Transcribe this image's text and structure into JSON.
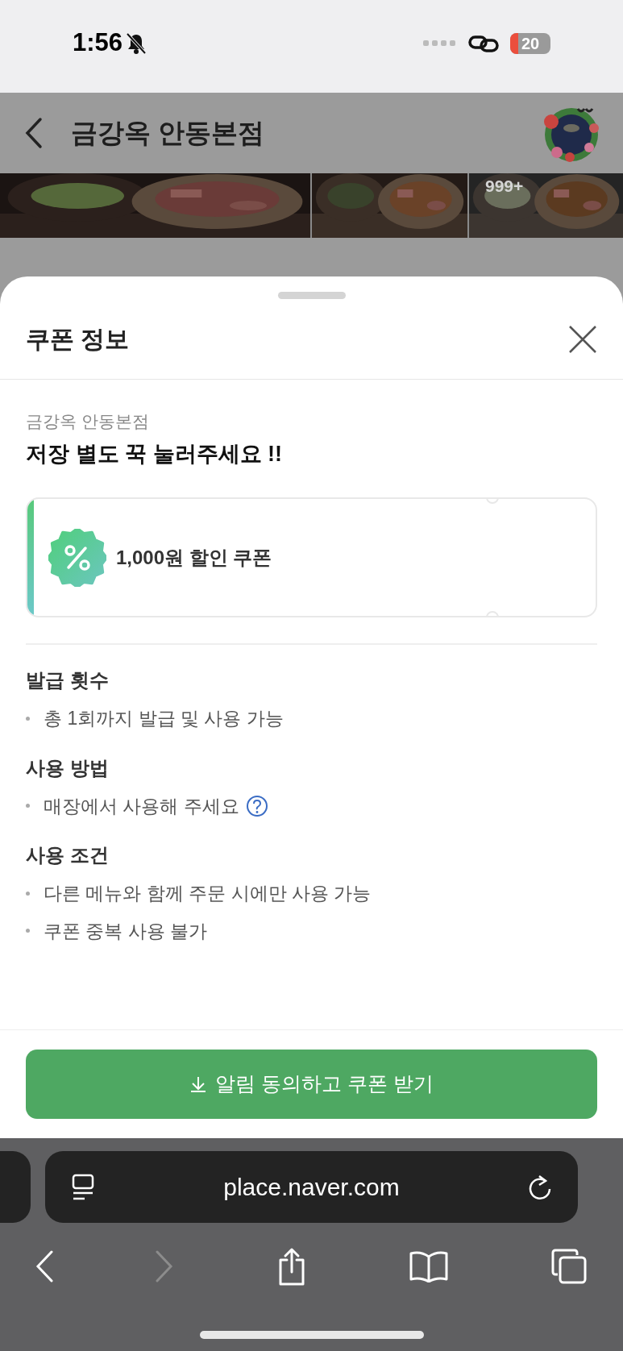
{
  "status_bar": {
    "time": "1:56",
    "battery": "20"
  },
  "header": {
    "title": "금강옥 안동본점"
  },
  "photos": [
    {
      "kind": "picture"
    },
    {
      "kind": "picture"
    },
    {
      "kind": "picture",
      "count": "999+"
    }
  ],
  "sheet": {
    "title": "쿠폰 정보",
    "store": "금강옥 안동본점",
    "headline": "저장 별도 꾹 눌러주세요 !!",
    "coupon": {
      "label": "1,000원 할인 쿠폰"
    },
    "sections": [
      {
        "title": "발급 횟수",
        "items": [
          {
            "text": "총 1회까지 발급 및 사용 가능",
            "help": false
          }
        ]
      },
      {
        "title": "사용 방법",
        "items": [
          {
            "text": "매장에서 사용해 주세요",
            "help": true
          }
        ]
      },
      {
        "title": "사용 조건",
        "items": [
          {
            "text": "다른 메뉴와 함께 주문 시에만 사용 가능",
            "help": false
          },
          {
            "text": "쿠폰 중복 사용 불가",
            "help": false
          }
        ]
      }
    ],
    "button": "알림 동의하고 쿠폰 받기"
  },
  "browser": {
    "url": "place.naver.com",
    "forward_disabled": true
  }
}
